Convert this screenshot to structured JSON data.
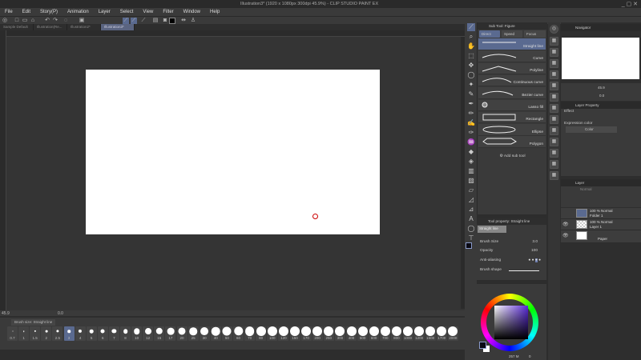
{
  "window": {
    "title": "Illustration3* (1920 x 1080px 300dpi 45.9%) - CLIP STUDIO PAINT EX",
    "controls": "_ ▢ ✕"
  },
  "menu": [
    "File",
    "Edit",
    "Story(P)",
    "Animation",
    "Layer",
    "Select",
    "View",
    "Filter",
    "Window",
    "Help"
  ],
  "doc_tabs": [
    "Sample Default",
    "Illustration(Re...",
    "Illustration2*",
    "Illustration3*"
  ],
  "status": {
    "zoom": "45.9",
    "angle": "0.0"
  },
  "brush_palette": {
    "title": "Brush size: Straight line",
    "selected": "3",
    "sizes": [
      "0.7",
      "1",
      "1.5",
      "2",
      "2.5",
      "3",
      "4",
      "5",
      "6",
      "7",
      "8",
      "10",
      "12",
      "15",
      "17",
      "20",
      "25",
      "30",
      "40",
      "50",
      "60",
      "70",
      "80",
      "100",
      "120",
      "150",
      "170",
      "200",
      "250",
      "300",
      "400",
      "500",
      "600",
      "700",
      "800",
      "1000",
      "1200",
      "1500",
      "1700",
      "2000"
    ]
  },
  "sub_tool": {
    "title": "Sub Tool: Figure",
    "groups": [
      "Direct",
      "Speed",
      "Focus"
    ],
    "items": [
      "Straight line",
      "Curve",
      "Polyline",
      "Continuous curve",
      "Bezier curve",
      "Lasso fill",
      "Rectangle",
      "Ellipse",
      "Polygon"
    ],
    "selected": "Straight line",
    "add_label": "Add sub tool"
  },
  "tool_property": {
    "title": "Tool property: Straight line",
    "preset": "Straight line",
    "brush_size_label": "Brush Size",
    "brush_size": "3.0",
    "opacity_label": "Opacity",
    "opacity": "100",
    "anti_alias_label": "Anti-aliasing",
    "brush_shape_label": "Brush shape"
  },
  "navigator": {
    "title": "Navigator",
    "zoom": "45.9",
    "angle": "0.0"
  },
  "layer_property": {
    "title": "Layer Property",
    "effect_label": "Effect",
    "expression_label": "Expression color",
    "expression_value": "Color"
  },
  "layer_panel": {
    "title": "Layer",
    "blend": "Normal",
    "layers": [
      {
        "line1": "100 % Normal",
        "line2": "Folder 1"
      },
      {
        "line1": "100 % Normal",
        "line2": "Layer 1"
      },
      {
        "line1": "",
        "line2": "Paper"
      }
    ]
  },
  "color": {
    "main": "#0a0a14",
    "sub": "#ffffff",
    "info": "257 M",
    "count": "0"
  }
}
